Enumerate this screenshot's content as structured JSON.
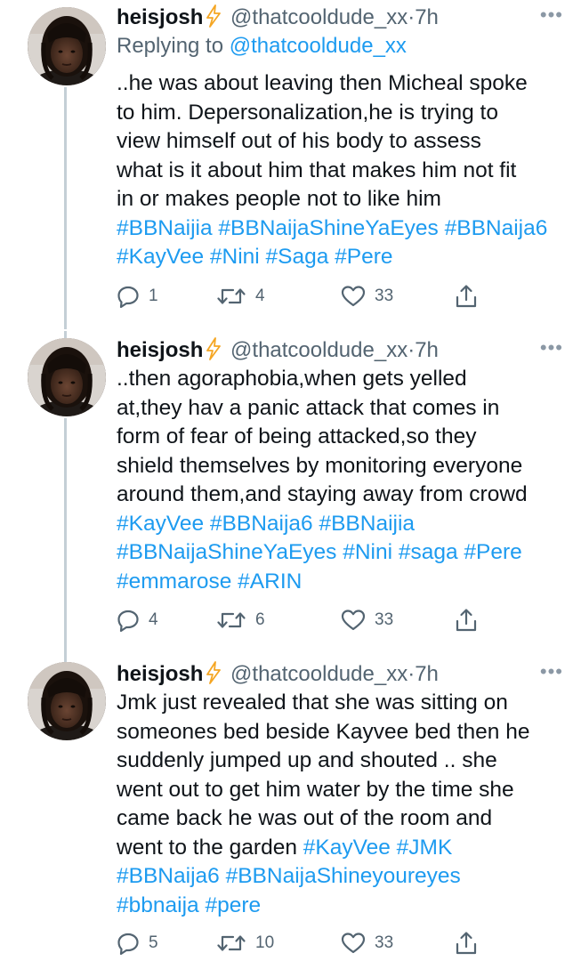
{
  "tweets": [
    {
      "author_name": "heisjosh",
      "handle": "@thatcooldude_xx",
      "separator": "·",
      "time": "7h",
      "more_label": "•••",
      "replying_prefix": "Replying to",
      "replying_to": "@thatcooldude_xx",
      "body_lines": [
        "..he was about leaving then Micheal spoke",
        "to him. Depersonalization,he is trying to",
        "view himself out of his body to assess",
        "what is it about him that makes him not fit",
        "in or makes people not to like him"
      ],
      "hashtag_lines": [
        "#BBNaijia #BBNaijaShineYaEyes #BBNaija6",
        "#KayVee #Nini #Saga #Pere"
      ],
      "replies": "1",
      "retweets": "4",
      "likes": "33"
    },
    {
      "author_name": "heisjosh",
      "handle": "@thatcooldude_xx",
      "separator": "·",
      "time": "7h",
      "more_label": "•••",
      "body_lines": [
        "..then agoraphobia,when gets yelled",
        "at,they hav a panic attack that comes in",
        "form of fear of being attacked,so they",
        "shield themselves by monitoring everyone",
        "around them,and staying away from crowd"
      ],
      "hashtag_lines": [
        "#KayVee #BBNaija6 #BBNaijia",
        "#BBNaijaShineYaEyes #Nini #saga #Pere",
        "#emmarose #ARIN"
      ],
      "replies": "4",
      "retweets": "6",
      "likes": "33"
    },
    {
      "author_name": "heisjosh",
      "handle": "@thatcooldude_xx",
      "separator": "·",
      "time": "7h",
      "more_label": "•••",
      "body_lines": [
        "Jmk just revealed that she was sitting on",
        "someones bed beside Kayvee bed then he",
        "suddenly jumped up and shouted .. she",
        "went out to get him water by the time she",
        "came back he was out of the room and"
      ],
      "last_line_text": "went to the garden ",
      "last_line_tags": "#KayVee #JMK",
      "hashtag_lines": [
        "#BBNaija6 #BBNaijaShineyoureyes",
        "#bbnaija #pere"
      ],
      "replies": "5",
      "retweets": "10",
      "likes": "33"
    }
  ],
  "icons": {
    "verified_emoji": "lightning-bolt-icon",
    "reply": "reply-icon",
    "retweet": "retweet-icon",
    "like": "heart-icon",
    "share": "share-icon"
  },
  "colors": {
    "link": "#1d9bf0",
    "muted": "#536471",
    "bolt": "#f5a623",
    "thread_line": "#c4cfd6"
  }
}
